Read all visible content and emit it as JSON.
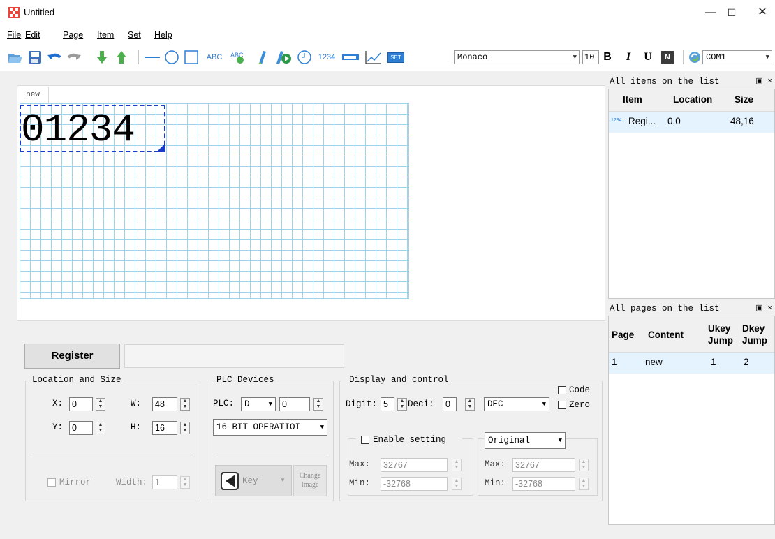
{
  "window": {
    "title": "Untitled",
    "minimize": "—",
    "maximize": "☐",
    "close": "✕"
  },
  "menu": [
    "File",
    "Edit",
    "Page",
    "Item",
    "Set",
    "Help"
  ],
  "toolbar": {
    "text_tool": "ABC",
    "num_tool": "1234",
    "set_tool": "SET",
    "font": "Monaco",
    "size": "10",
    "bold": "B",
    "italic": "I",
    "underline": "U",
    "n_btn": "N",
    "port": "COM1"
  },
  "canvas": {
    "tab": "new",
    "item_text": "01234"
  },
  "items_panel": {
    "title": "All items on the list",
    "pin": "▣ ×",
    "columns": [
      "Item",
      "Location",
      "Size"
    ],
    "rows": [
      {
        "icon": "1234",
        "item": "Regi...",
        "location": "0,0",
        "size": "48,16"
      }
    ]
  },
  "pages_panel": {
    "title": "All pages on the list",
    "pin": "▣ ×",
    "columns": [
      "Page",
      "Content",
      "Ukey Jump",
      "Dkey Jump"
    ],
    "col_ukey_1": "Ukey",
    "col_ukey_2": "Jump",
    "col_dkey_1": "Dkey",
    "col_dkey_2": "Jump",
    "rows": [
      {
        "page": "1",
        "content": "new",
        "ukey": "1",
        "dkey": "2"
      }
    ]
  },
  "props": {
    "type_button": "Register",
    "location": {
      "title": "Location and Size",
      "x_label": "X:",
      "x": "0",
      "w_label": "W:",
      "w": "48",
      "y_label": "Y:",
      "y": "0",
      "h_label": "H:",
      "h": "16",
      "mirror": "Mirror",
      "width_label": "Width:",
      "width": "1"
    },
    "plc": {
      "title": "PLC Devices",
      "plc_label": "PLC:",
      "device": "D",
      "address": "0",
      "operation": "16 BIT OPERATIOI",
      "key": "Key",
      "change_image_1": "Change",
      "change_image_2": "Image"
    },
    "display": {
      "title": "Display and control",
      "code": "Code",
      "zero": "Zero",
      "digit_label": "Digit:",
      "digit": "5",
      "deci_label": "Deci:",
      "deci": "0",
      "format": "DEC",
      "enable_setting": "Enable setting",
      "mode": "Original",
      "max_label": "Max:",
      "max1": "32767",
      "min_label": "Min:",
      "min1": "-32768",
      "max2": "32767",
      "min2": "-32768"
    }
  }
}
